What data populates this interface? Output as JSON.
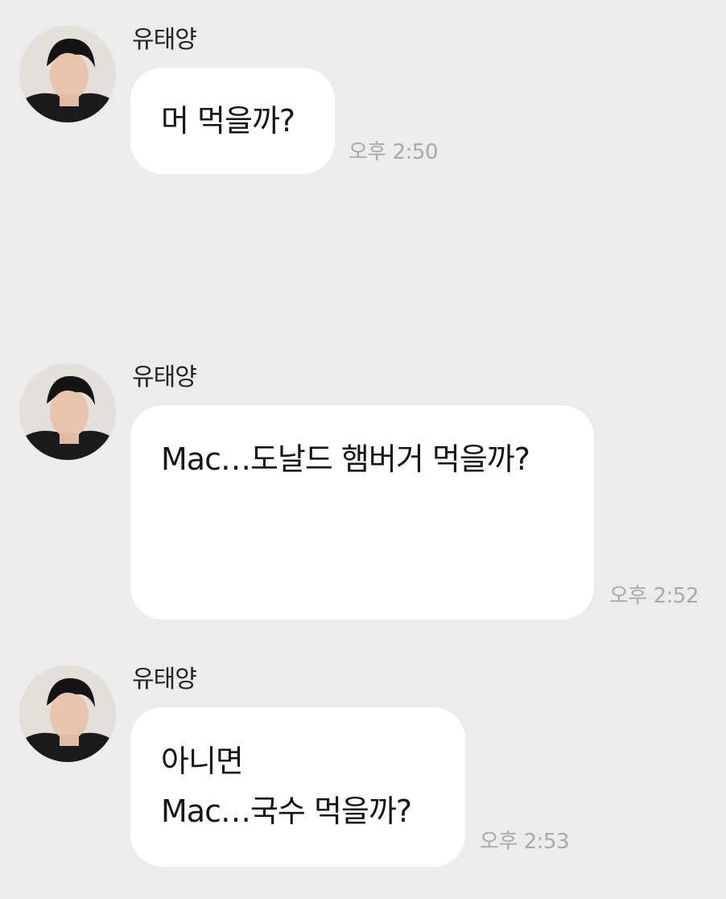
{
  "chat": {
    "messages": [
      {
        "sender": "유태양",
        "avatar": "profile-photo",
        "lines": [
          "머 먹을까?"
        ],
        "time": "오후 2:50"
      },
      {
        "sender": "유태양",
        "avatar": "profile-photo",
        "lines": [
          "Mac…도날드 햄버거 먹을까?"
        ],
        "time": "오후 2:52"
      },
      {
        "sender": "유태양",
        "avatar": "profile-photo",
        "lines": [
          "아니면",
          "Mac…국수 먹을까?"
        ],
        "time": "오후 2:53"
      }
    ]
  },
  "colors": {
    "background": "#ececec",
    "bubble": "#ffffff",
    "time_text": "#a9a9a9"
  }
}
